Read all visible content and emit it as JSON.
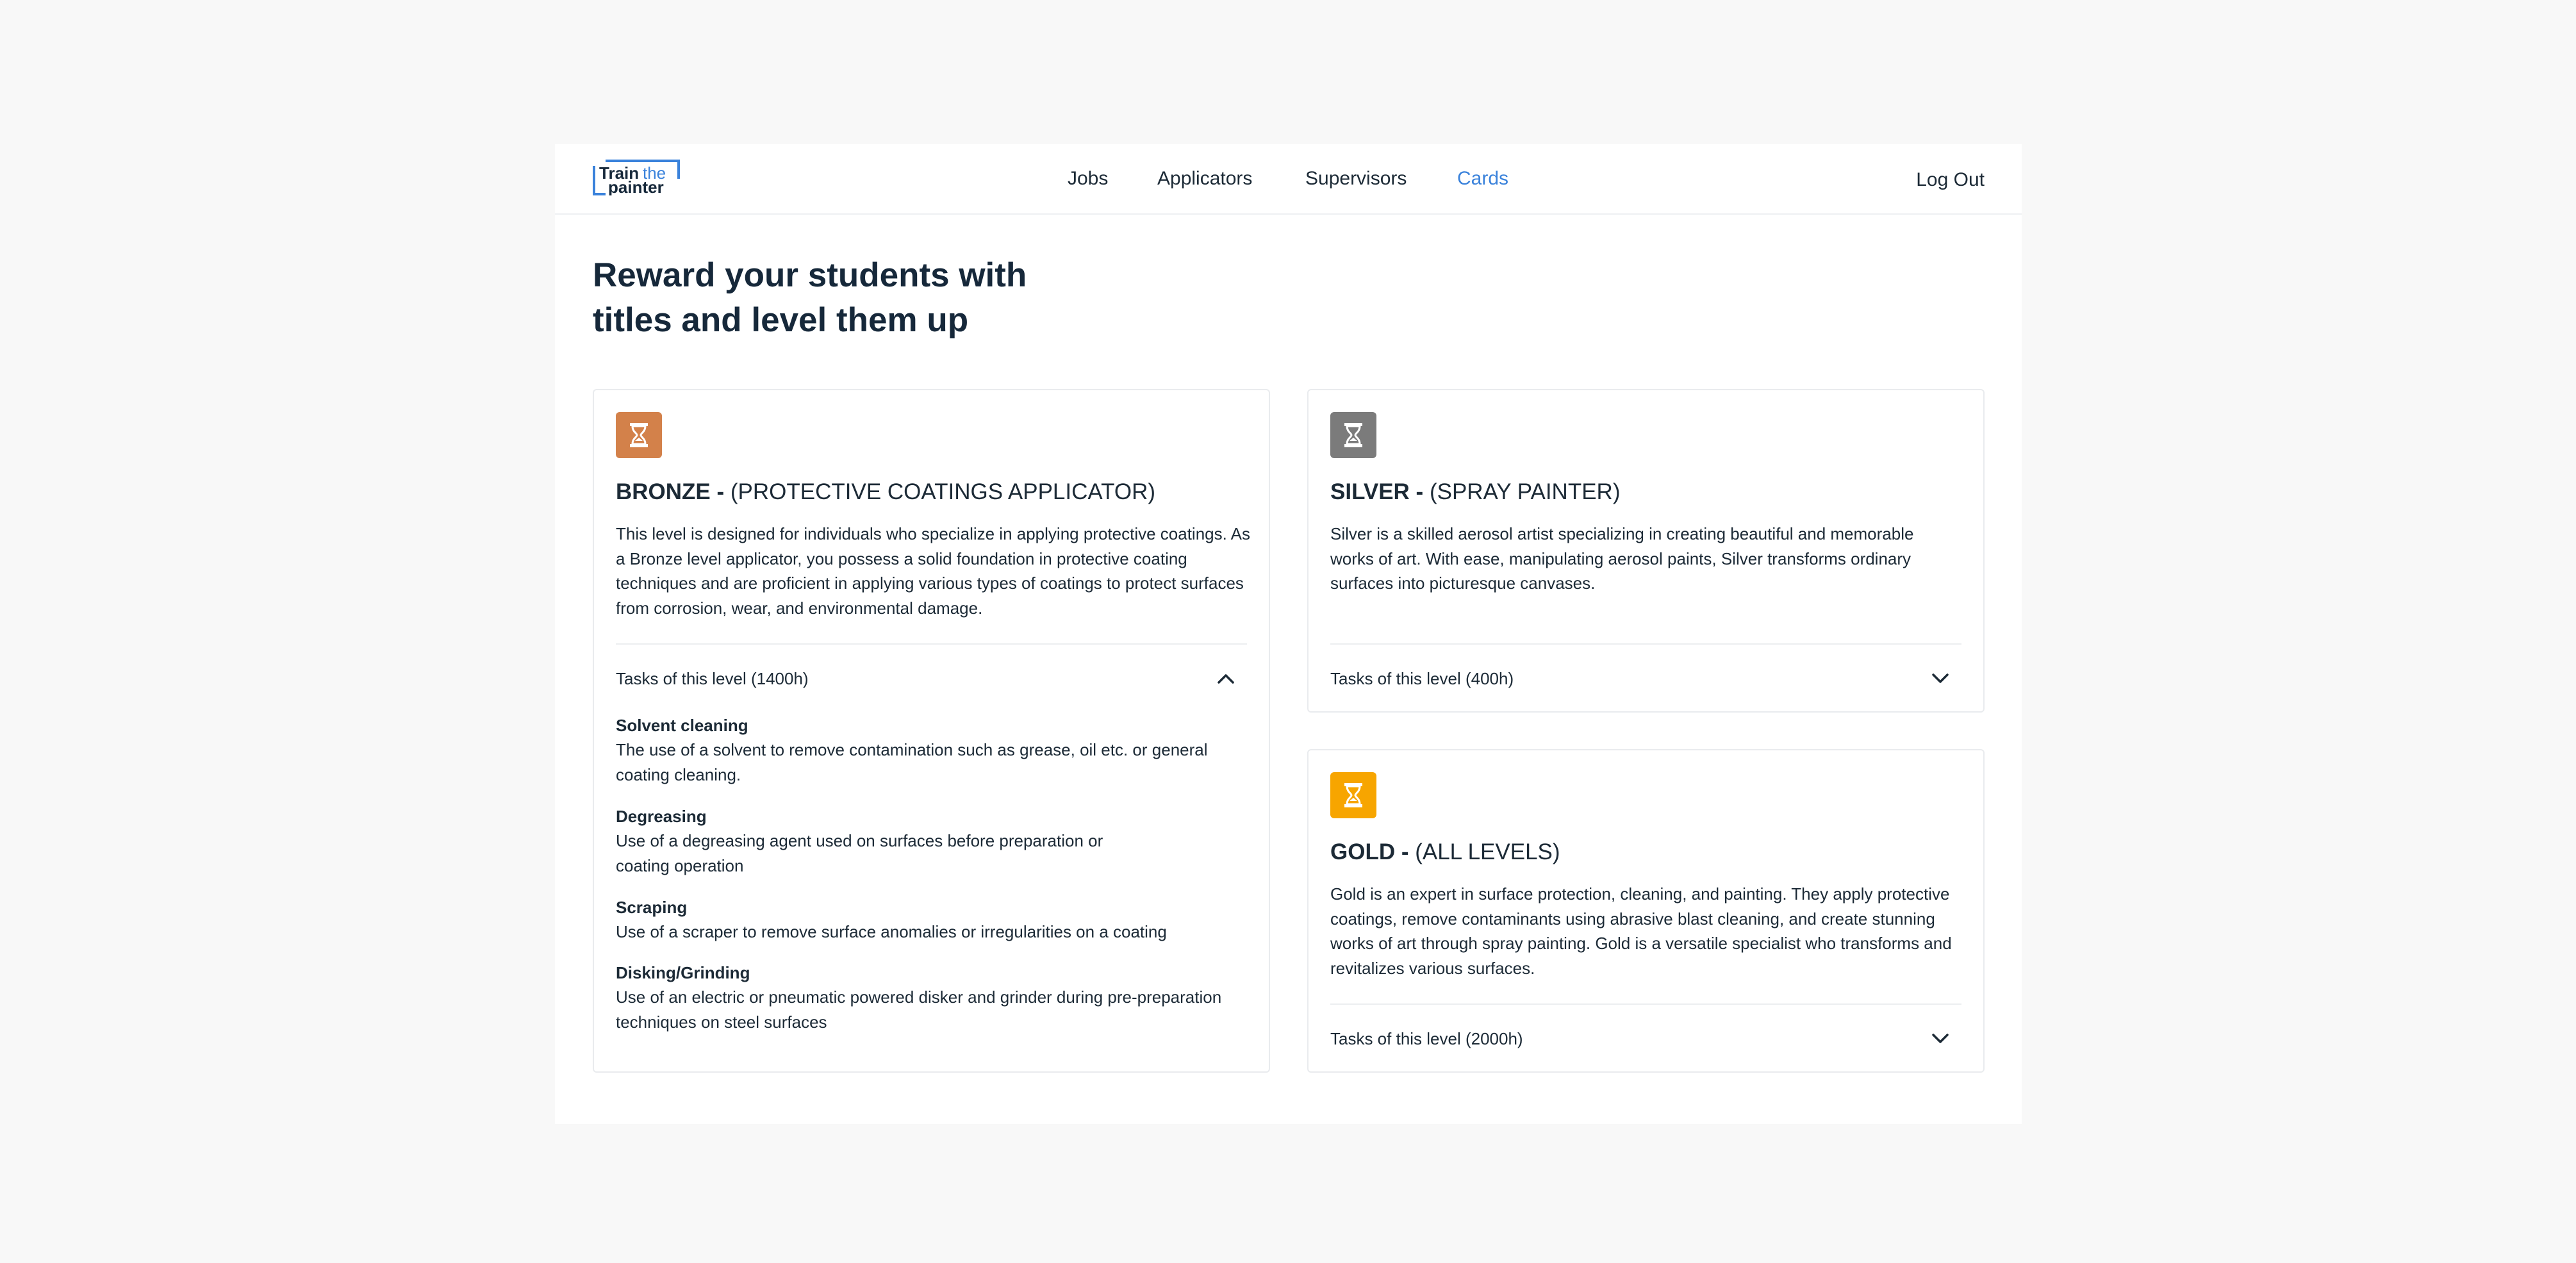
{
  "nav": {
    "logo_text": "Train the painter",
    "links": [
      "Jobs",
      "Applicators",
      "Supervisors",
      "Cards"
    ],
    "active": "Cards",
    "logout_label": "Log Out"
  },
  "page": {
    "title_line1": "Reward your students with",
    "title_line2": "titles and level them up"
  },
  "cards": {
    "bronze": {
      "level": "BRONZE -",
      "role": "(PROTECTIVE COATINGS APPLICATOR)",
      "badge_color": "#d3814a",
      "description": "This level is designed for individuals who specialize in applying protective coatings. As a Bronze level applicator, you possess a solid foundation in protective coating techniques and are proficient in applying various types of coatings to protect surfaces from corrosion, wear, and environmental damage.",
      "tasks_label": "Tasks of this level (1400h)",
      "expanded": true,
      "tasks": [
        {
          "name": "Solvent cleaning",
          "desc": "The use of a solvent to remove contamination such as grease, oil etc. or general coating cleaning."
        },
        {
          "name": "Degreasing",
          "desc": "Use of a degreasing agent used on surfaces before preparation or coating operation"
        },
        {
          "name": "Scraping",
          "desc": "Use of a scraper to remove surface anomalies or irregularities on a coating"
        },
        {
          "name": "Disking/Grinding",
          "desc": "Use of an electric or pneumatic powered disker and grinder during pre-preparation techniques on steel surfaces"
        }
      ]
    },
    "silver": {
      "level": "SILVER -",
      "role": "(SPRAY PAINTER)",
      "badge_color": "#7b7b7b",
      "description": "Silver is a skilled aerosol artist specializing in creating beautiful and memorable works of art. With ease, manipulating aerosol paints, Silver transforms ordinary surfaces into picturesque canvases.",
      "tasks_label": "Tasks of this level (400h)",
      "expanded": false
    },
    "gold": {
      "level": "GOLD -",
      "role": "(ALL LEVELS)",
      "badge_color": "#f7a500",
      "description": "Gold is an expert in surface protection, cleaning, and painting. They apply protective coatings, remove contaminants using abrasive blast cleaning, and create stunning works of art through spray painting. Gold is a versatile specialist who transforms and revitalizes various surfaces.",
      "tasks_label": "Tasks of this level (2000h)",
      "expanded": false
    }
  },
  "colors": {
    "accent": "#3a82db",
    "text": "#1c2a36",
    "background": "#f8f8f8"
  }
}
